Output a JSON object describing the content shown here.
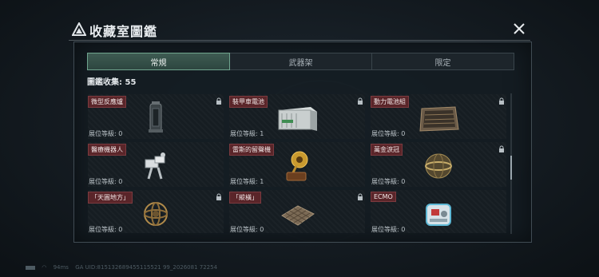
{
  "window": {
    "title": "收藏室圖鑑",
    "close_label": "×"
  },
  "tabs": [
    {
      "label": "常規",
      "active": true
    },
    {
      "label": "武器架",
      "active": false
    },
    {
      "label": "限定",
      "active": false
    }
  ],
  "collection": {
    "label": "圖鑑收集:",
    "value": "55"
  },
  "items": [
    {
      "name": "微型反應爐",
      "level": "展位等級: 0",
      "locked": true,
      "icon": "reactor-icon"
    },
    {
      "name": "裝甲車電池",
      "level": "展位等級: 1",
      "locked": true,
      "icon": "battery-crate-icon"
    },
    {
      "name": "動力電池組",
      "level": "展位等級: 0",
      "locked": true,
      "icon": "power-cell-icon"
    },
    {
      "name": "醫療機器人",
      "level": "展位等級: 0",
      "locked": false,
      "icon": "medical-robot-icon"
    },
    {
      "name": "雷斯的留聲機",
      "level": "展位等級: 1",
      "locked": false,
      "icon": "gramophone-icon"
    },
    {
      "name": "萬金淚冠",
      "level": "展位等級: 0",
      "locked": true,
      "icon": "crown-icon"
    },
    {
      "name": "「天圓地方」",
      "level": "展位等級: 0",
      "locked": true,
      "icon": "armillary-icon"
    },
    {
      "name": "「縱橫」",
      "level": "展位等級: 0",
      "locked": true,
      "icon": "chessboard-icon"
    },
    {
      "name": "ECMO",
      "level": "展位等級: 0",
      "locked": false,
      "icon": "ecmo-icon"
    }
  ],
  "footer": {
    "ping": "94ms",
    "uid": "GA UID:815132689455115521 99_2026081 72254"
  },
  "colors": {
    "tab_active": "#3e5b52",
    "name_tag": "#5a2529",
    "background": "#141b21"
  }
}
